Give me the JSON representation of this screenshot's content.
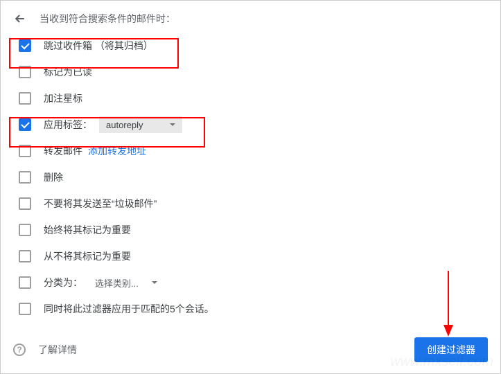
{
  "header": {
    "title": "当收到符合搜索条件的邮件时："
  },
  "options": [
    {
      "key": "skip_inbox",
      "label": "跳过收件箱 （将其归档）",
      "checked": true
    },
    {
      "key": "mark_read",
      "label": "标记为已读",
      "checked": false
    },
    {
      "key": "star",
      "label": "加注星标",
      "checked": false
    },
    {
      "key": "apply_label",
      "label": "应用标签：",
      "checked": true,
      "dropdown": "autoreply",
      "dropdown_style": "filled"
    },
    {
      "key": "forward",
      "label": "转发邮件",
      "checked": false,
      "link": "添加转发地址"
    },
    {
      "key": "delete",
      "label": "删除",
      "checked": false
    },
    {
      "key": "never_spam",
      "label": "不要将其发送至“垃圾邮件”",
      "checked": false
    },
    {
      "key": "always_important",
      "label": "始终将其标记为重要",
      "checked": false
    },
    {
      "key": "never_important",
      "label": "从不将其标记为重要",
      "checked": false
    },
    {
      "key": "categorize",
      "label": "分类为：",
      "checked": false,
      "dropdown": "选择类别...",
      "dropdown_style": "plain"
    },
    {
      "key": "apply_to_matching",
      "label": "同时将此过滤器应用于匹配的5个会话。",
      "checked": false
    }
  ],
  "footer": {
    "learn_more": "了解详情",
    "create_button": "创建过滤器"
  },
  "colors": {
    "primary": "#1a73e8",
    "highlight": "#f00"
  }
}
